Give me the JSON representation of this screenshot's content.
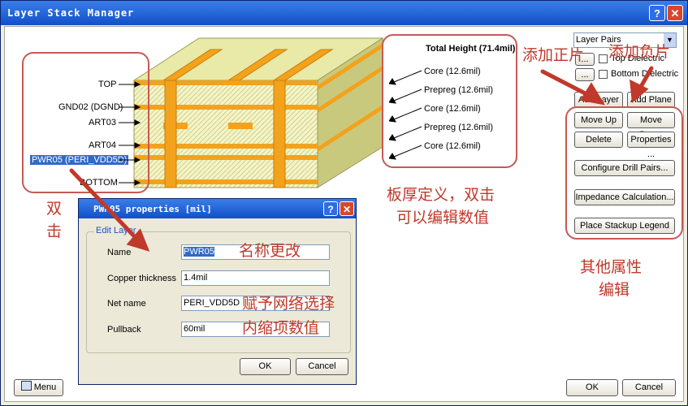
{
  "window": {
    "title": "Layer Stack Manager"
  },
  "stack": {
    "left_layers": [
      "TOP",
      "GND02 (DGND)",
      "ART03",
      "ART04",
      "PWR05 (PERI_VDD5D)",
      "BOTTOM"
    ],
    "total_height": "Total Height (71.4mil)",
    "right_layers": [
      "Core (12.6mil)",
      "Prepreg (12.6mil)",
      "Core (12.6mil)",
      "Prepreg (12.6mil)",
      "Core (12.6mil)"
    ]
  },
  "controls": {
    "layer_pairs": "Layer Pairs",
    "top_dielectric": "Top Dielectric",
    "bottom_dielectric": "Bottom Dielectric",
    "ellipsis": "...",
    "add_layer": "Add Layer",
    "add_plane": "Add Plane",
    "move_up": "Move Up",
    "move_down": "Move Down",
    "delete": "Delete",
    "properties": "Properties ...",
    "configure_drill_pairs": "Configure Drill Pairs...",
    "impedance_calculation": "Impedance Calculation...",
    "place_stackup_legend": "Place Stackup Legend"
  },
  "footer": {
    "menu": "Menu",
    "ok": "OK",
    "cancel": "Cancel"
  },
  "dialog": {
    "title": "PWR05 properties [mil]",
    "group": "Edit Layer",
    "name_label": "Name",
    "name_value": "PWR05",
    "copper_label": "Copper thickness",
    "copper_value": "1.4mil",
    "net_label": "Net name",
    "net_value": "PERI_VDD5D",
    "pullback_label": "Pullback",
    "pullback_value": "60mil",
    "ok": "OK",
    "cancel": "Cancel"
  },
  "annotations": {
    "add_positive": "添加正片",
    "add_negative": "添加负片",
    "double_click_1": "双",
    "double_click_2": "击",
    "thickness_1": "板厚定义，双击",
    "thickness_2": "可以编辑数值",
    "other_1": "其他属性",
    "other_2": "编辑",
    "rename": "名称更改",
    "net_select": "赋予网络选择",
    "pullback": "内缩项数值"
  },
  "colors": {
    "annotation": "#c0392b",
    "title_bar": "#1c5fd6",
    "copper": "#f3a21c",
    "dielectric": "#f3f3c4"
  }
}
